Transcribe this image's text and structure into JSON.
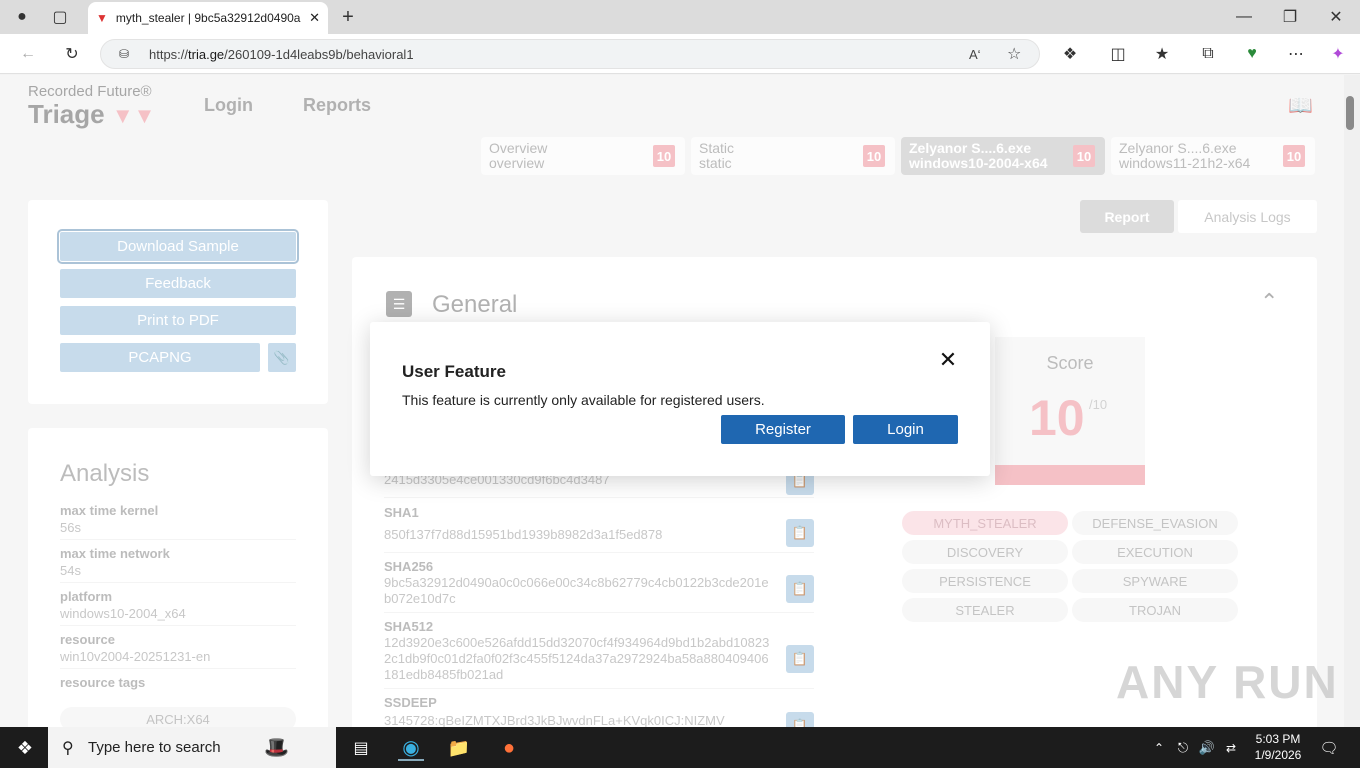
{
  "browser": {
    "tab_title": "myth_stealer | 9bc5a32912d0490a",
    "url_prefix": "https://",
    "url_host": "tria.ge",
    "url_path": "/260109-1d4leabs9b/behavioral1"
  },
  "header": {
    "brand_top": "Recorded Future®",
    "brand_main": "Triage",
    "nav_login": "Login",
    "nav_reports": "Reports"
  },
  "report_tabs": [
    {
      "line1": "Overview",
      "line2": "overview",
      "score": "10"
    },
    {
      "line1": "Static",
      "line2": "static",
      "score": "10"
    },
    {
      "line1": "Zelyanor S....6.exe",
      "line2": "windows10-2004-x64",
      "score": "10"
    },
    {
      "line1": "Zelyanor S....6.exe",
      "line2": "windows11-21h2-x64",
      "score": "10"
    }
  ],
  "view_tabs": {
    "report": "Report",
    "logs": "Analysis Logs"
  },
  "actions": {
    "download": "Download Sample",
    "feedback": "Feedback",
    "pdf": "Print to PDF",
    "pcap": "PCAPNG"
  },
  "analysis": {
    "title": "Analysis",
    "items": [
      {
        "label": "max time kernel",
        "value": "56s"
      },
      {
        "label": "max time network",
        "value": "54s"
      },
      {
        "label": "platform",
        "value": "windows10-2004_x64"
      },
      {
        "label": "resource",
        "value": "win10v2004-20251231-en"
      },
      {
        "label": "resource tags",
        "value": ""
      }
    ],
    "tag": "ARCH:X64"
  },
  "general": {
    "title": "General",
    "hashes": [
      {
        "label": "",
        "value": "2415d3305e4ce001330cd9f6bc4d3487"
      },
      {
        "label": "SHA1",
        "value": "850f137f7d88d15951bd1939b8982d3a1f5ed878"
      },
      {
        "label": "SHA256",
        "value": "9bc5a32912d0490a0c0c066e00c34c8b62779c4cb0122b3cde201eb072e10d7c"
      },
      {
        "label": "SHA512",
        "value": "12d3920e3c600e526afdd15dd32070cf4f934964d9bd1b2abd108232c1db9f0c01d2fa0f02f3c455f5124da37a2972924ba58a880409406181edb8485fb021ad"
      },
      {
        "label": "SSDEEP",
        "value": "3145728:qBeIZMTXJBrd3JkBJwvdnFLa+KVqk0ICJ:NIZMV"
      }
    ],
    "score_label": "Score",
    "score_value": "10",
    "score_max": "/10",
    "tags": [
      "MYTH_STEALER",
      "DEFENSE_EVASION",
      "DISCOVERY",
      "EXECUTION",
      "PERSISTENCE",
      "SPYWARE",
      "STEALER",
      "TROJAN"
    ]
  },
  "modal": {
    "title": "User Feature",
    "text": "This feature is currently only available for registered users.",
    "register": "Register",
    "login": "Login",
    "close": "✕"
  },
  "taskbar": {
    "search_placeholder": "Type here to search",
    "time": "5:03 PM",
    "date": "1/9/2026"
  },
  "watermark": "ANY RUN",
  "colors": {
    "accent": "#1f67b1",
    "score": "#f0a0a8",
    "action": "#a9c8e0"
  }
}
